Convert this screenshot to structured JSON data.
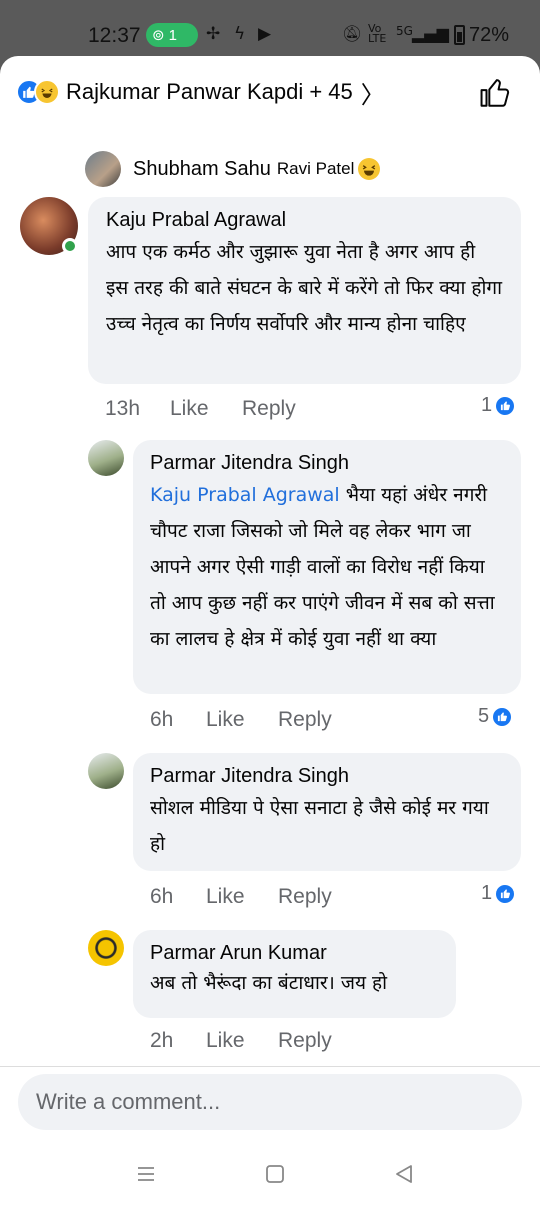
{
  "status": {
    "time": "12:37",
    "hotspot_count": "1",
    "battery": "72%",
    "network_label": "5G"
  },
  "header": {
    "reactors": "Rajkumar Panwar Kapdi + 45",
    "chevron": "〉"
  },
  "reply_preview": {
    "author": "Shubham Sahu",
    "text": "Ravi Patel"
  },
  "comments": [
    {
      "author": "Kaju Prabal Agrawal",
      "text": "आप एक कर्मठ और जुझारू युवा नेता है अगर आप ही इस तरह की बाते संघटन के बारे में करेंगे तो फिर क्या होगा उच्च नेतृत्व का निर्णय सर्वोपरि और मान्य होना चाहिए",
      "time": "13h",
      "like": "Like",
      "reply": "Reply",
      "reactions": "1"
    },
    {
      "author": "Parmar Jitendra Singh",
      "mention": "Kaju Prabal Agrawal",
      "text": " भैया यहां अंधेर नगरी चौपट राजा जिसको जो मिले वह लेकर भाग जा आपने अगर ऐसी गाड़ी वालों का विरोध नहीं किया तो आप कुछ नहीं कर पाएंगे जीवन में सब को सत्ता का लालच हे क्षेत्र में कोई युवा नहीं था क्या",
      "time": "6h",
      "like": "Like",
      "reply": "Reply",
      "reactions": "5"
    },
    {
      "author": "Parmar Jitendra Singh",
      "text": "सोशल मीडिया पे ऐसा सनाटा हे जैसे कोई मर गया हो",
      "time": "6h",
      "like": "Like",
      "reply": "Reply",
      "reactions": "1"
    },
    {
      "author": "Parmar Arun Kumar",
      "text": "अब तो भैरूंदा का बंटाधार। जय हो",
      "time": "2h",
      "like": "Like",
      "reply": "Reply"
    }
  ],
  "composer": {
    "placeholder": "Write a comment..."
  },
  "icons": {
    "like": "like-icon",
    "haha": "haha-icon"
  },
  "colors": {
    "accent": "#1877f2",
    "mention": "#216fdb",
    "bubble": "#f0f2f5",
    "online": "#31a24c"
  }
}
